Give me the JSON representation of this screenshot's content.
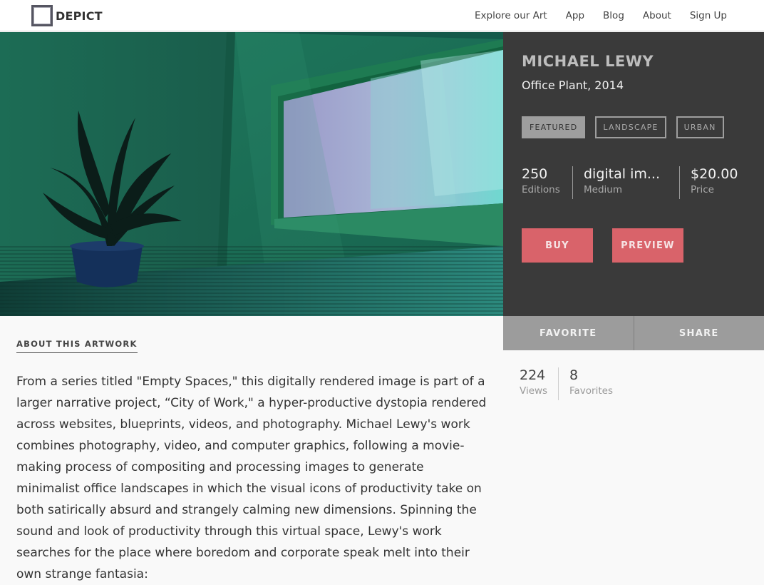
{
  "brand": {
    "name": "DEPICT"
  },
  "nav": {
    "items": [
      "Explore our Art",
      "App",
      "Blog",
      "About",
      "Sign Up"
    ]
  },
  "artwork": {
    "artist": "MICHAEL LEWY",
    "title": "Office Plant, 2014",
    "tags": [
      "FEATURED",
      "LANDSCAPE",
      "URBAN"
    ],
    "active_tag": "FEATURED",
    "editions": {
      "value": "250",
      "label": "Editions"
    },
    "medium": {
      "value": "digital im...",
      "label": "Medium"
    },
    "price": {
      "value": "$20.00",
      "label": "Price"
    },
    "buy_label": "BUY",
    "preview_label": "PREVIEW"
  },
  "actions": {
    "favorite_label": "FAVORITE",
    "share_label": "SHARE"
  },
  "engagement": {
    "views": {
      "value": "224",
      "label": "Views"
    },
    "favorites": {
      "value": "8",
      "label": "Favorites"
    }
  },
  "about": {
    "heading": "ABOUT THIS ARTWORK",
    "text": "From a series titled \"Empty Spaces,\" this digitally rendered image is part of a larger narrative project, “City of Work,\" a hyper-productive dystopia rendered across websites, blueprints, videos, and photography. Michael Lewy's work combines photography, video, and computer graphics, following a movie-making process of compositing and processing images to generate minimalist office landscapes in which the visual icons of productivity take on both satirically absurd and strangely calming new dimensions. Spinning the sound and look of productivity through this virtual space, Lewy's work searches for the place where boredom and corporate speak melt into their own strange fantasia:"
  },
  "colors": {
    "accent": "#d9636a",
    "panel": "#3a3a3a",
    "action_bar": "#9c9c9c",
    "room_green": "#1f6b55"
  },
  "icons": {
    "logo": "depict-square-logo-icon"
  }
}
